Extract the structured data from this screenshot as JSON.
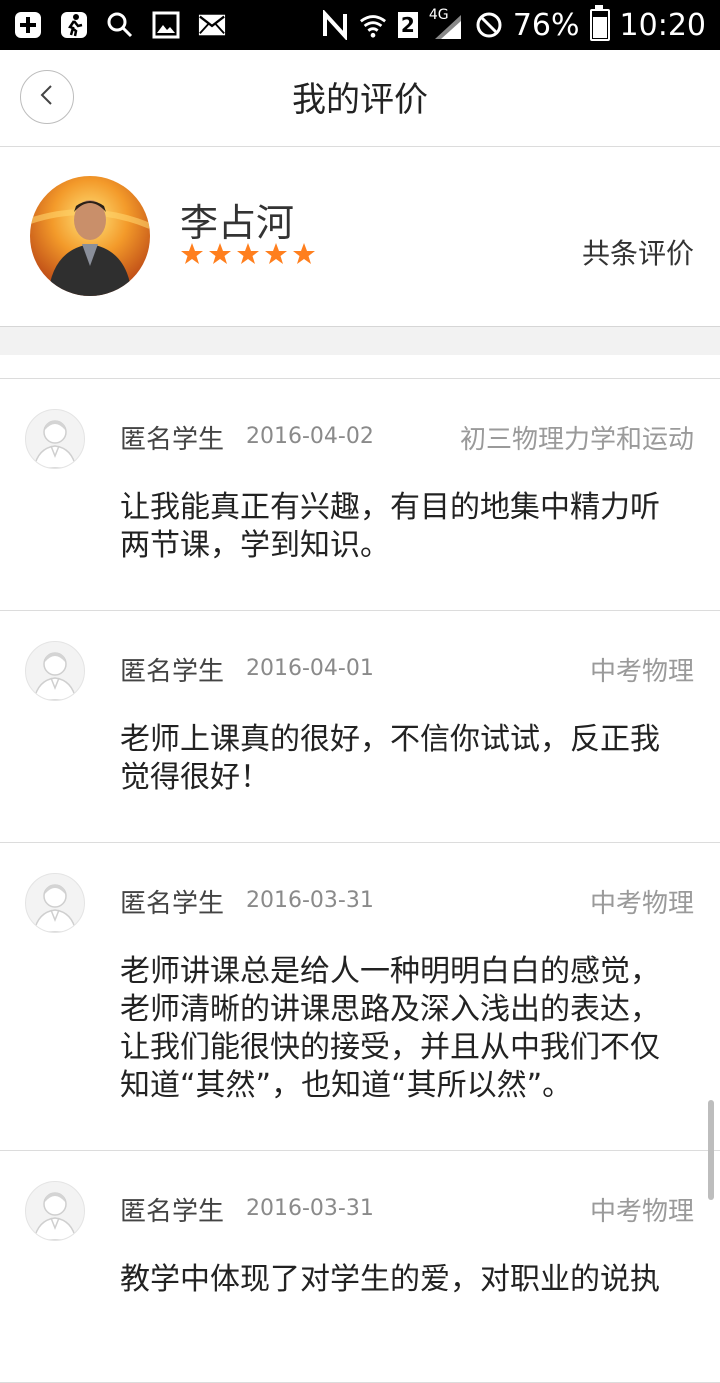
{
  "status_bar": {
    "battery": "76%",
    "time": "10:20",
    "network": "4G",
    "sim": "2",
    "left_icons": [
      "add-icon",
      "run-icon",
      "search-icon",
      "image-icon",
      "mail-icon"
    ],
    "right_icons": [
      "nfc-icon",
      "wifi-icon",
      "sim-icon",
      "signal-icon",
      "block-icon",
      "battery-icon"
    ]
  },
  "header": {
    "title": "我的评价",
    "back_icon": "chevron-left-icon"
  },
  "teacher": {
    "name": "李占河",
    "stars": 5,
    "review_count": "共条评价"
  },
  "reviews": [
    {
      "author": "匿名学生",
      "date": "2016-04-02",
      "course": "初三物理力学和运动",
      "text": "让我能真正有兴趣，有目的地集中精力听两节课，学到知识。"
    },
    {
      "author": "匿名学生",
      "date": "2016-04-01",
      "course": "中考物理",
      "text": "老师上课真的很好，不信你试试，反正我觉得很好！"
    },
    {
      "author": "匿名学生",
      "date": "2016-03-31",
      "course": "中考物理",
      "text": "老师讲课总是给人一种明明白白的感觉，老师清晰的讲课思路及深入浅出的表达，让我们能很快的接受，并且从中我们不仅知道“其然”，也知道“其所以然”。"
    },
    {
      "author": "匿名学生",
      "date": "2016-03-31",
      "course": "中考物理",
      "text": "教学中体现了对学生的爱，对职业的说执"
    }
  ],
  "colors": {
    "star": "#ff7f1e",
    "status_bar": "#000000",
    "divider": "#dcdcdc"
  }
}
